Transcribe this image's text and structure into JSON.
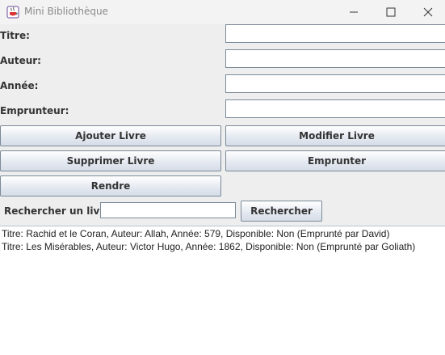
{
  "window": {
    "title": "Mini Bibliothèque",
    "icon": "java-coffee-cup-icon"
  },
  "form": {
    "titre_label": "Titre:",
    "auteur_label": "Auteur:",
    "annee_label": "Année:",
    "emprunteur_label": "Emprunteur:",
    "titre_value": "",
    "auteur_value": "",
    "annee_value": "",
    "emprunteur_value": ""
  },
  "buttons": {
    "ajouter": "Ajouter Livre",
    "modifier": "Modifier Livre",
    "supprimer": "Supprimer Livre",
    "emprunter": "Emprunter",
    "rendre": "Rendre"
  },
  "search": {
    "label": "Rechercher un livre:",
    "value": "",
    "button": "Rechercher"
  },
  "results": [
    "Titre: Rachid et le Coran, Auteur: Allah, Année: 579, Disponible: Non (Emprunté par David)",
    "Titre: Les Misérables, Auteur: Victor Hugo, Année: 1862, Disponible: Non (Emprunté par Goliath)"
  ]
}
